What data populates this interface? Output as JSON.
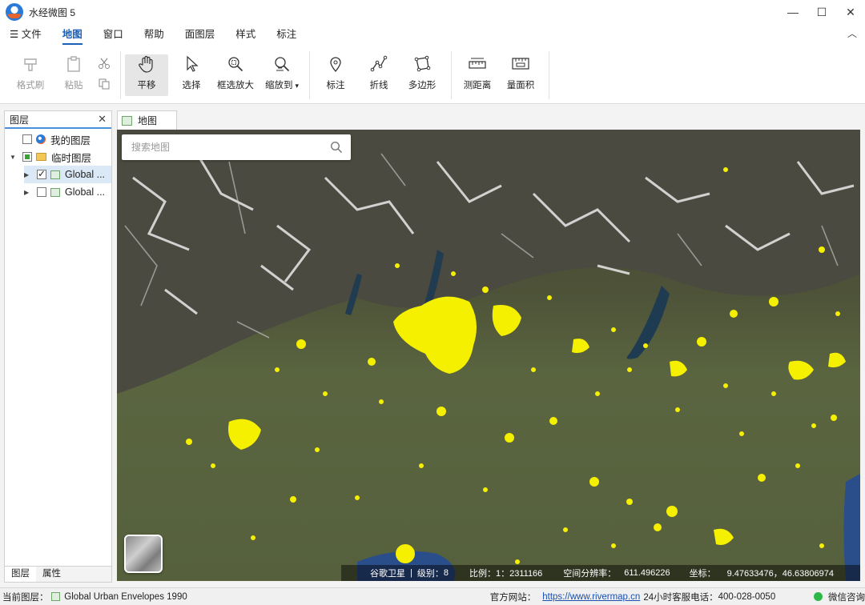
{
  "window": {
    "title": "水经微图 5",
    "minimize_glyph": "—",
    "maximize_glyph": "☐",
    "close_glyph": "✕"
  },
  "menu": {
    "file_icon": "☰",
    "file": "文件",
    "tabs": [
      "地图",
      "窗口",
      "帮助",
      "面图层",
      "样式",
      "标注"
    ],
    "active_tab": "地图",
    "collapse_glyph": "︿"
  },
  "ribbon": {
    "format_painter": "格式刷",
    "paste": "粘贴",
    "pan": "平移",
    "select": "选择",
    "box_zoom": "框选放大",
    "zoom_to": "缩放到",
    "zoom_to_caret": "▾",
    "mark": "标注",
    "polyline": "折线",
    "polygon": "多边形",
    "measure_distance": "测距离",
    "measure_area": "量面积"
  },
  "layer_panel": {
    "title": "图层",
    "close_glyph": "✕",
    "items": [
      {
        "label": "我的图层",
        "checked": false
      },
      {
        "label": "临时图层",
        "checked": "partial"
      },
      {
        "label": "Global ...",
        "checked": true
      },
      {
        "label": "Global ...",
        "checked": false
      }
    ],
    "tabs": [
      "图层",
      "属性"
    ]
  },
  "map": {
    "tab_label": "地图",
    "search_placeholder": "搜索地图",
    "info": {
      "source": "谷歌卫星",
      "level_label": "级别：",
      "level": "8",
      "scale_label": "比例：",
      "scale": "1：2311166",
      "resolution_label": "空间分辨率：",
      "resolution": "611.496226",
      "coord_label": "坐标：",
      "coords": "9.47633476，46.63806974"
    },
    "colors": {
      "urban": "#f5ef00",
      "terrain": "#56603f"
    }
  },
  "status": {
    "current_layer_label": "当前图层：",
    "current_layer": "Global Urban Envelopes 1990",
    "website_label": "官方网站：",
    "website": "https://www.rivermap.cn",
    "phone_label": "24小时客服电话：",
    "phone": "400-028-0050",
    "wechat": "微信咨询"
  }
}
